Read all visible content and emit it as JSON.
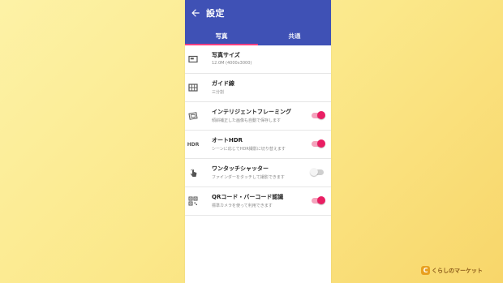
{
  "app": {
    "title": "設定",
    "tabs": [
      {
        "label": "写真",
        "active": true
      },
      {
        "label": "共通",
        "active": false
      }
    ]
  },
  "settings": [
    {
      "icon": "image-size-icon",
      "title": "写真サイズ",
      "subtitle": "12.0M (4000x3000)"
    },
    {
      "icon": "grid-icon",
      "title": "ガイド線",
      "subtitle": "三分割"
    },
    {
      "icon": "framing-icon",
      "title": "インテリジェントフレーミング",
      "subtitle": "傾斜補正した画像も自動で保存します",
      "toggle": "on"
    },
    {
      "icon": "hdr-icon",
      "title": "オートHDR",
      "subtitle": "シーンに応じてHDR撮影に切り替えます",
      "toggle": "on"
    },
    {
      "icon": "touch-icon",
      "title": "ワンタッチシャッター",
      "subtitle": "ファインダーをタッチして撮影できます",
      "toggle": "off"
    },
    {
      "icon": "qr-icon",
      "title": "QRコード・バーコード認識",
      "subtitle": "標準カメラを使って利用できます",
      "toggle": "on"
    }
  ],
  "watermark": {
    "text": "くらしのマーケット",
    "mark": "C"
  },
  "colors": {
    "appbar": "#3f51b5",
    "accent": "#e91e63",
    "indicator": "#ff4081"
  }
}
